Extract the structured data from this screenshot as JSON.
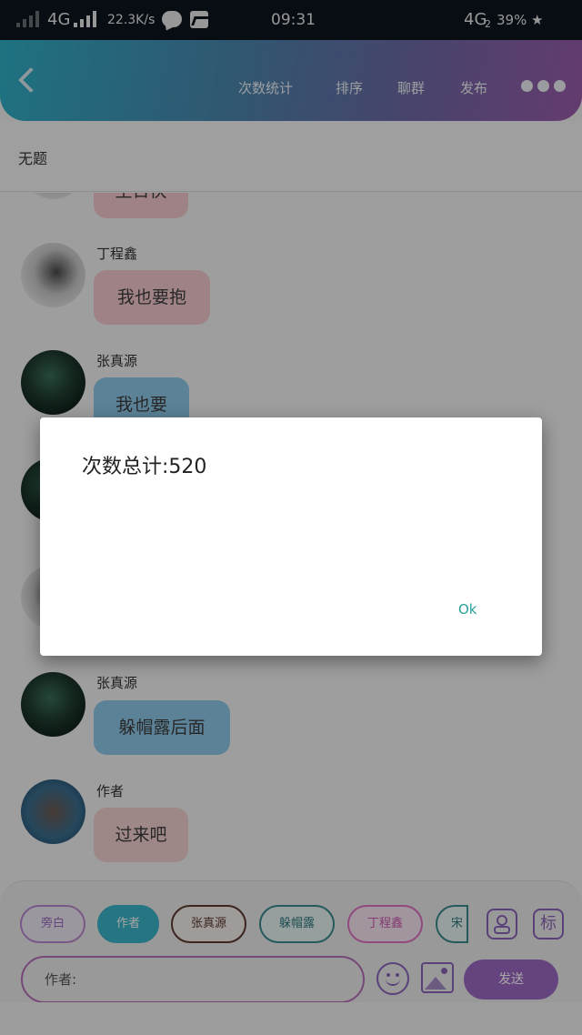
{
  "status_bar": {
    "network": "4G",
    "speed": "22.3K/s",
    "time": "09:31",
    "network2": "4G",
    "sim": "2",
    "battery": "39%"
  },
  "header": {
    "menu": [
      "次数统计",
      "排序",
      "聊群",
      "发布"
    ]
  },
  "page_title": "无题",
  "messages": [
    {
      "name": "",
      "text": "生日快",
      "avatar": "gray-portrait",
      "color": "pink"
    },
    {
      "name": "丁程鑫",
      "text": "我也要抱",
      "avatar": "gray-portrait",
      "color": "pink"
    },
    {
      "name": "张真源",
      "text": "我也要",
      "avatar": "night-scene",
      "color": "blue"
    },
    {
      "name": "",
      "text": "",
      "avatar": "night-scene",
      "color": "blue"
    },
    {
      "name": "",
      "text": "",
      "avatar": "gray-portrait",
      "color": "pink"
    },
    {
      "name": "张真源",
      "text": "躲帽露后面",
      "avatar": "night-scene",
      "color": "blue"
    },
    {
      "name": "作者",
      "text": "过来吧",
      "avatar": "blue-portrait",
      "color": "rose"
    }
  ],
  "chips": [
    {
      "label": "旁白",
      "style": "outline-purple"
    },
    {
      "label": "作者",
      "style": "filled-teal"
    },
    {
      "label": "张真源",
      "style": "outline-brown"
    },
    {
      "label": "躲帽露",
      "style": "outline-teal"
    },
    {
      "label": "丁程鑫",
      "style": "outline-pink"
    },
    {
      "label": "宋",
      "style": "outline-teal"
    }
  ],
  "tag_button": "标",
  "input": {
    "placeholder": "作者:"
  },
  "send_label": "发送",
  "dialog": {
    "message": "次数总计:520",
    "ok": "Ok"
  },
  "colors": {
    "accent": "#9b68c4",
    "teal": "#2aa39a",
    "header_start": "#2fb0c6",
    "header_end": "#9a5cab"
  }
}
